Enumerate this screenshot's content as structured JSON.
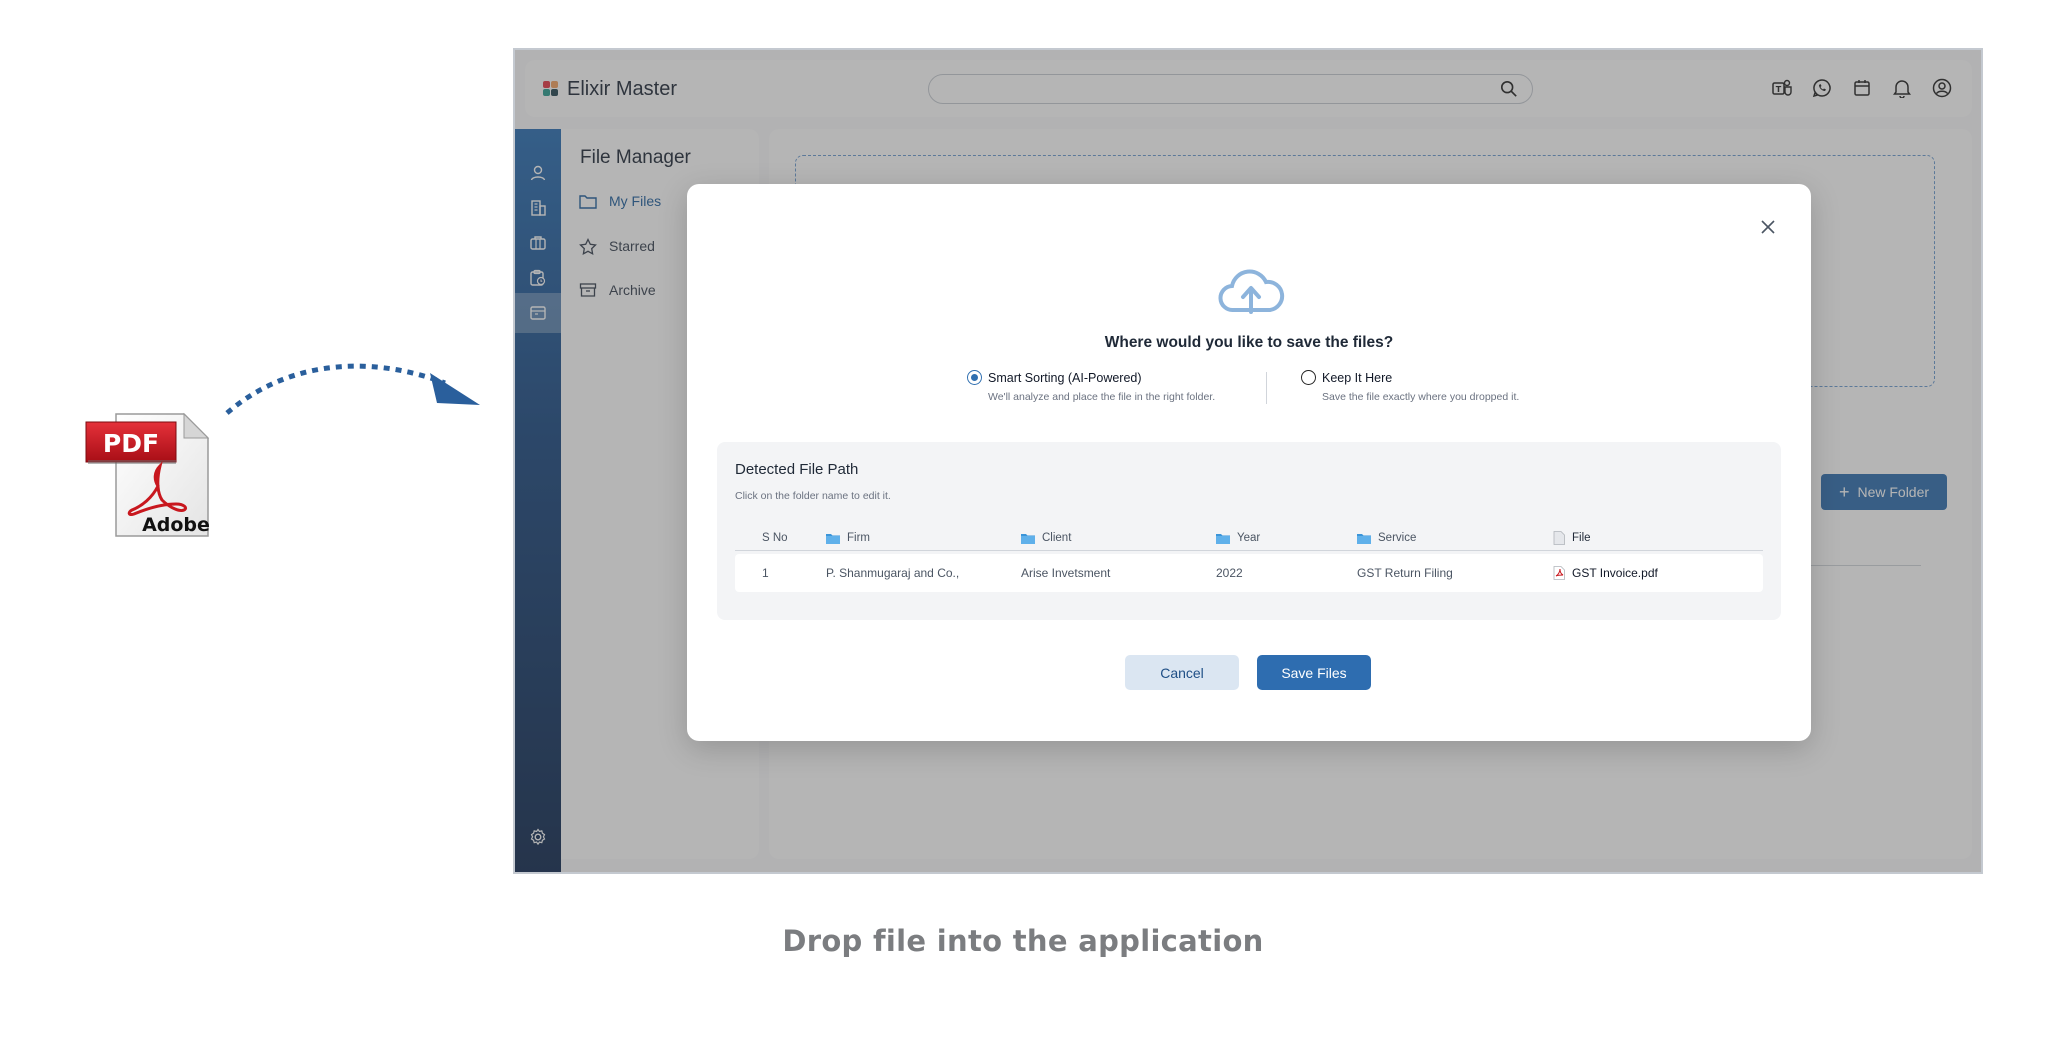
{
  "caption": "Drop file into the application",
  "pdf_icon": {
    "badge": "PDF",
    "brand": "Adobe"
  },
  "app": {
    "brand_name": "Elixir Master",
    "search": {
      "placeholder": "",
      "value": ""
    },
    "top_icons": [
      "teams-icon",
      "whatsapp-icon",
      "calendar-icon",
      "bell-icon",
      "user-circle-icon"
    ],
    "rail_icons": [
      "user-icon",
      "building-icon",
      "briefcase-icon",
      "clipboard-clock-icon",
      "file-cabinet-icon",
      "settings-icon"
    ],
    "file_manager": {
      "title": "File Manager",
      "items": [
        {
          "label": "My Files",
          "icon": "folder-icon",
          "active": true
        },
        {
          "label": "Starred",
          "icon": "star-icon",
          "active": false
        },
        {
          "label": "Archive",
          "icon": "archive-icon",
          "active": false
        }
      ]
    },
    "new_folder_label": "New Folder"
  },
  "modal": {
    "question": "Where would you like to save the files?",
    "options": [
      {
        "label": "Smart Sorting (AI-Powered)",
        "desc": "We'll analyze and place the file in the right folder.",
        "selected": true
      },
      {
        "label": "Keep It Here",
        "desc": "Save the file exactly where you dropped it.",
        "selected": false
      }
    ],
    "path_card": {
      "title": "Detected File Path",
      "subtitle": "Click on the folder name to edit it.",
      "columns": [
        "S No",
        "Firm",
        "Client",
        "Year",
        "Service",
        "File"
      ],
      "row": {
        "sno": "1",
        "firm": "P. Shanmugaraj and Co.,",
        "client": "Arise Invetsment",
        "year": "2022",
        "service": "GST Return Filing",
        "file": "GST Invoice.pdf"
      }
    },
    "cancel_label": "Cancel",
    "save_label": "Save Files"
  },
  "colors": {
    "accent": "#2e6db0",
    "rail_top": "#2a6fb4",
    "rail_bottom": "#10294f",
    "overlay": "rgba(70,70,70,0.40)",
    "pdf_red": "#c8171e"
  }
}
